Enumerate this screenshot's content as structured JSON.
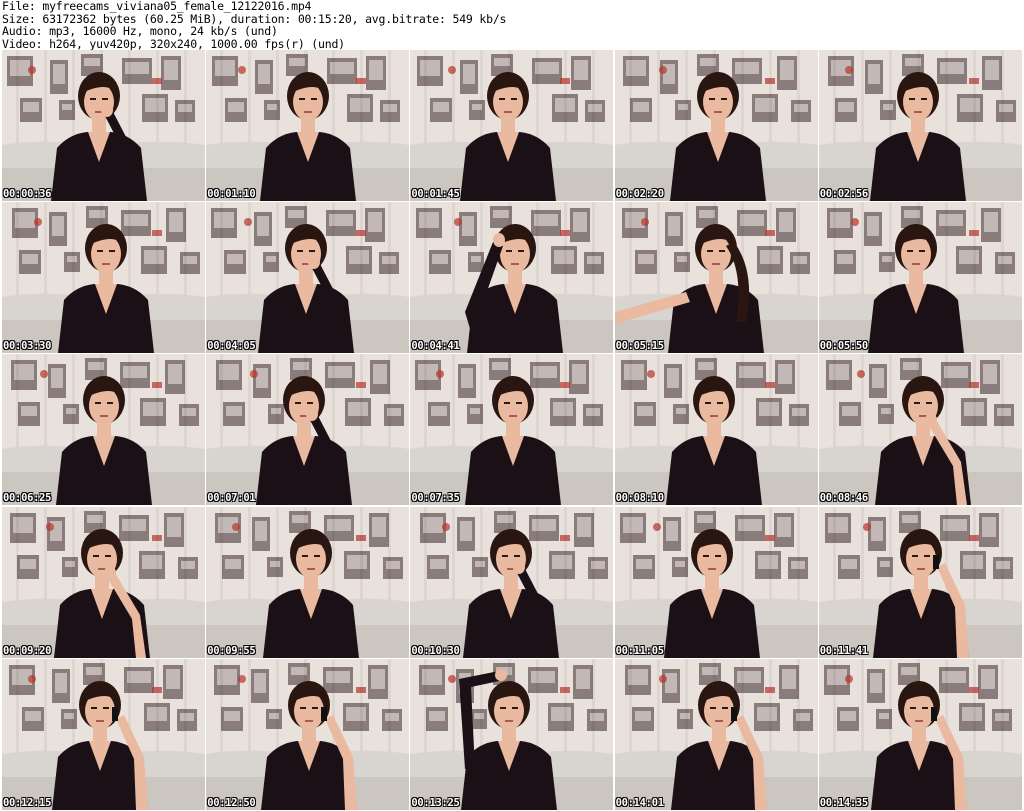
{
  "header": {
    "file_line": "File: myfreecams_viviana05_female_12122016.mp4",
    "size_line": "Size: 63172362 bytes (60.25 MiB), duration: 00:15:20, avg.bitrate: 549 kb/s",
    "audio_line": "Audio: mp3, 16000 Hz, mono, 24 kb/s (und)",
    "video_line": "Video: h264, yuv420p, 320x240, 1000.00 fps(r) (und)"
  },
  "thumbnails": [
    {
      "timestamp": "00:00:36",
      "pose": "hand-mouth"
    },
    {
      "timestamp": "00:01:10",
      "pose": "neutral"
    },
    {
      "timestamp": "00:01:45",
      "pose": "neutral"
    },
    {
      "timestamp": "00:02:20",
      "pose": "neutral"
    },
    {
      "timestamp": "00:02:56",
      "pose": "neutral"
    },
    {
      "timestamp": "00:03:30",
      "pose": "neutral"
    },
    {
      "timestamp": "00:04:05",
      "pose": "hand-mouth"
    },
    {
      "timestamp": "00:04:41",
      "pose": "hand-hair"
    },
    {
      "timestamp": "00:05:15",
      "pose": "lean"
    },
    {
      "timestamp": "00:05:50",
      "pose": "neutral"
    },
    {
      "timestamp": "00:06:25",
      "pose": "neutral"
    },
    {
      "timestamp": "00:07:01",
      "pose": "hand-mouth"
    },
    {
      "timestamp": "00:07:35",
      "pose": "neutral"
    },
    {
      "timestamp": "00:08:10",
      "pose": "neutral"
    },
    {
      "timestamp": "00:08:46",
      "pose": "hand-chin"
    },
    {
      "timestamp": "00:09:20",
      "pose": "hand-chin"
    },
    {
      "timestamp": "00:09:55",
      "pose": "neutral"
    },
    {
      "timestamp": "00:10:30",
      "pose": "hand-mouth"
    },
    {
      "timestamp": "00:11:05",
      "pose": "neutral"
    },
    {
      "timestamp": "00:11:41",
      "pose": "phone"
    },
    {
      "timestamp": "00:12:15",
      "pose": "phone"
    },
    {
      "timestamp": "00:12:50",
      "pose": "phone"
    },
    {
      "timestamp": "00:13:25",
      "pose": "arm-up"
    },
    {
      "timestamp": "00:14:01",
      "pose": "phone"
    },
    {
      "timestamp": "00:14:35",
      "pose": "phone"
    }
  ],
  "colors": {
    "background": "#ffffff",
    "text": "#000000",
    "curtain": "#e8e1dc",
    "curtain_print": "#3a2a2a",
    "sofa": "#d8d4cf",
    "top": "#1a1016",
    "skin": "#e9b9a0",
    "hair": "#2a1610"
  }
}
